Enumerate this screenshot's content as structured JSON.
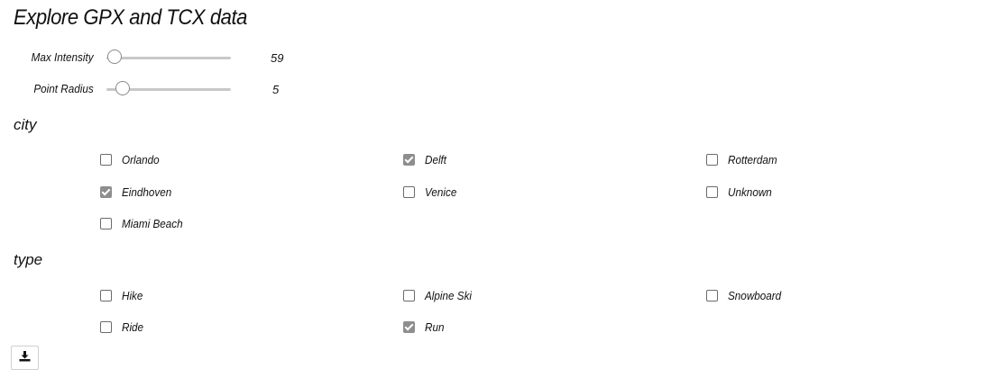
{
  "title": "Explore GPX and TCX data",
  "sliders": [
    {
      "label": "Max Intensity",
      "value": "59",
      "fraction": 0.0
    },
    {
      "label": "Point Radius",
      "value": "5",
      "fraction": 0.05
    }
  ],
  "city": {
    "heading": "city",
    "options": [
      {
        "label": "Orlando",
        "checked": false
      },
      {
        "label": "Delft",
        "checked": true
      },
      {
        "label": "Rotterdam",
        "checked": false
      },
      {
        "label": "Eindhoven",
        "checked": true
      },
      {
        "label": "Venice",
        "checked": false
      },
      {
        "label": "Unknown",
        "checked": false
      },
      {
        "label": "Miami Beach",
        "checked": false
      }
    ]
  },
  "type": {
    "heading": "type",
    "options": [
      {
        "label": "Hike",
        "checked": false
      },
      {
        "label": "Alpine Ski",
        "checked": false
      },
      {
        "label": "Snowboard",
        "checked": false
      },
      {
        "label": "Ride",
        "checked": false
      },
      {
        "label": "Run",
        "checked": true
      }
    ]
  },
  "download_icon": "download-icon"
}
